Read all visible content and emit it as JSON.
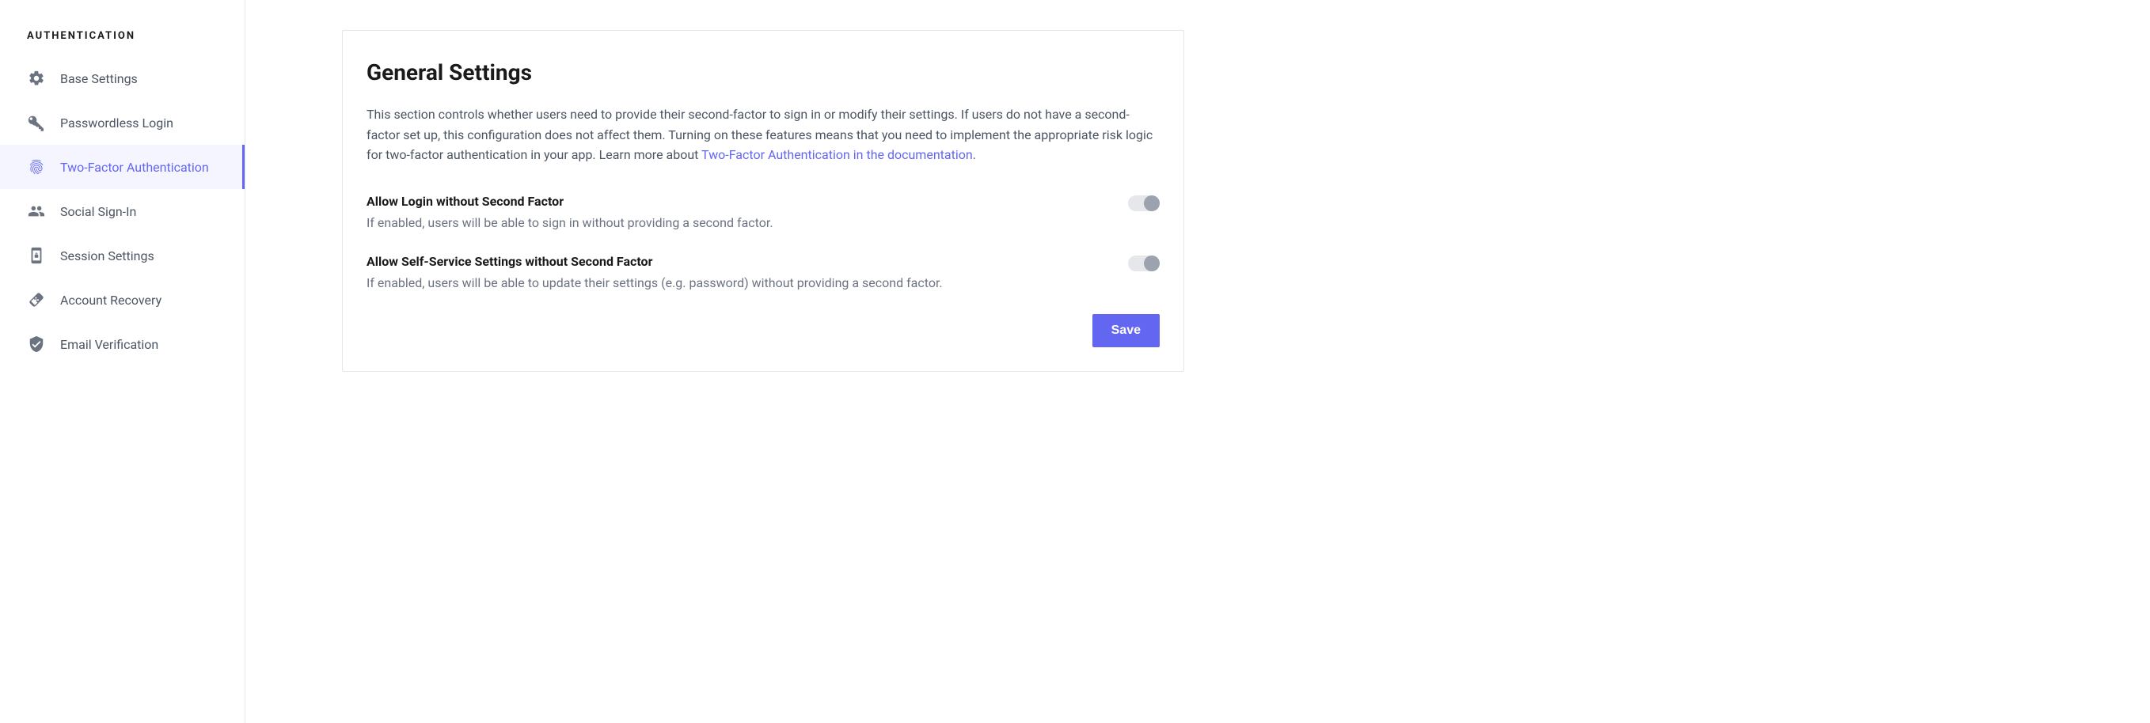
{
  "sidebar": {
    "heading": "AUTHENTICATION",
    "items": [
      {
        "label": "Base Settings"
      },
      {
        "label": "Passwordless Login"
      },
      {
        "label": "Two-Factor Authentication"
      },
      {
        "label": "Social Sign-In"
      },
      {
        "label": "Session Settings"
      },
      {
        "label": "Account Recovery"
      },
      {
        "label": "Email Verification"
      }
    ]
  },
  "main": {
    "title": "General Settings",
    "description_before_link": "This section controls whether users need to provide their second-factor to sign in or modify their settings. If users do not have a second-factor set up, this configuration does not affect them. Turning on these features means that you need to implement the appropriate risk logic for two-factor authentication in your app. Learn more about ",
    "link_text": "Two-Factor Authentication in the documentation",
    "description_after_link": ".",
    "settings": [
      {
        "title": "Allow Login without Second Factor",
        "description": "If enabled, users will be able to sign in without providing a second factor.",
        "enabled": false
      },
      {
        "title": "Allow Self-Service Settings without Second Factor",
        "description": "If enabled, users will be able to update their settings (e.g. password) without providing a second factor.",
        "enabled": false
      }
    ],
    "save_label": "Save"
  }
}
